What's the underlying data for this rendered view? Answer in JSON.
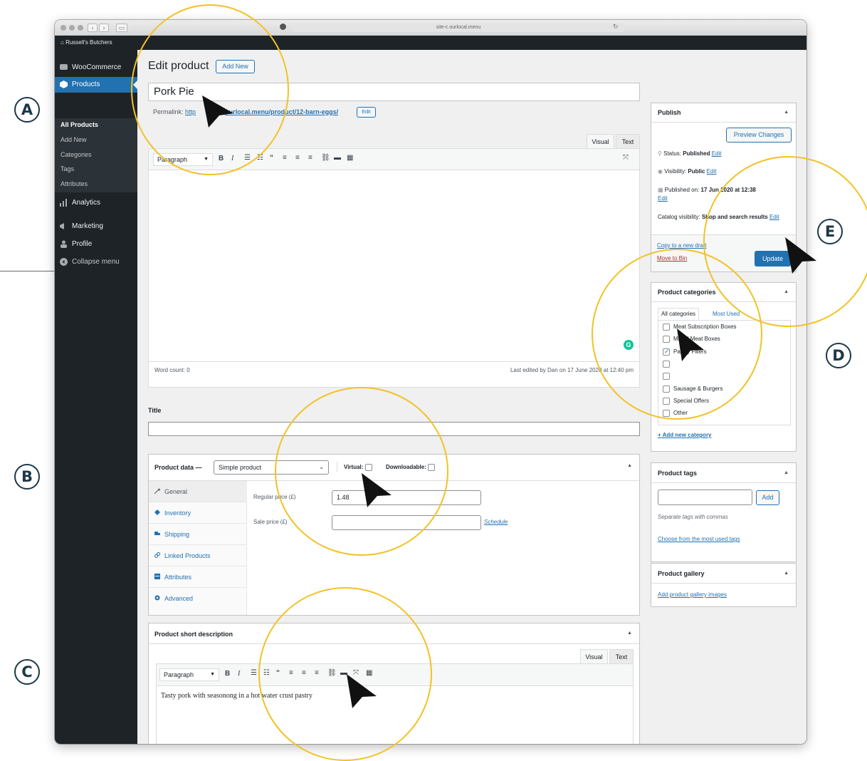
{
  "badges": {
    "a": "A",
    "b": "B",
    "c": "C",
    "d": "D",
    "e": "E"
  },
  "browser": {
    "url": "site-c.ourlocal.menu",
    "site_name": "Russell's Butchers"
  },
  "sidebar": {
    "woocommerce": "WooCommerce",
    "products": "Products",
    "submenu": [
      "All Products",
      "Add New",
      "Categories",
      "Tags",
      "Attributes"
    ],
    "analytics": "Analytics",
    "marketing": "Marketing",
    "profile": "Profile",
    "collapse": "Collapse menu"
  },
  "header": {
    "title": "Edit product",
    "add_new": "Add New"
  },
  "product": {
    "name": "Pork Pie",
    "permalink_label": "Permalink:",
    "permalink_start": "http",
    "permalink_end": "ourlocal.menu/product/12-barn-eggs/",
    "permalink_edit": "Edit"
  },
  "editor": {
    "tab_visual": "Visual",
    "tab_text": "Text",
    "format": "Paragraph",
    "word_count": "Word count: 0",
    "last_edited": "Last edited by Dan on 17 June 2020 at 12:40 pm"
  },
  "title_field": {
    "label": "Title"
  },
  "product_data": {
    "label": "Product data —",
    "type": "Simple product",
    "virtual": "Virtual:",
    "downloadable": "Downloadable:",
    "tabs": [
      "General",
      "Inventory",
      "Shipping",
      "Linked Products",
      "Attributes",
      "Advanced"
    ],
    "regular_price_label": "Regular price (£)",
    "regular_price": "1.48",
    "sale_price_label": "Sale price (£)",
    "schedule": "Schedule"
  },
  "short_desc": {
    "title": "Product short description",
    "tab_visual": "Visual",
    "tab_text": "Text",
    "format": "Paragraph",
    "content": "Tasty pork with seasonong in a hot water crust pastry"
  },
  "publish": {
    "title": "Publish",
    "preview": "Preview Changes",
    "status_label": "Status:",
    "status_value": "Published",
    "visibility_label": "Visibility:",
    "visibility_value": "Public",
    "published_on_label": "Published on:",
    "published_on_value": "17 Jun 2020 at 12:38",
    "catalog_label": "Catalog visibility:",
    "catalog_value": "Shop and search results",
    "edit": "Edit",
    "copy": "Copy to a new draft",
    "bin": "Move to Bin",
    "update": "Update"
  },
  "categories": {
    "title": "Product categories",
    "tab_all": "All categories",
    "tab_most": "Most Used",
    "items": [
      {
        "label": "Meat Subscription Boxes",
        "checked": false
      },
      {
        "label": "Mixed Meat Boxes",
        "checked": false
      },
      {
        "label": "Pantry Fillers",
        "checked": true
      },
      {
        "label": "",
        "checked": false
      },
      {
        "label": "",
        "checked": false
      },
      {
        "label": "Sausage & Burgers",
        "checked": false
      },
      {
        "label": "Special Offers",
        "checked": false
      },
      {
        "label": "Other",
        "checked": false
      }
    ],
    "add_new": "+ Add new category"
  },
  "tags": {
    "title": "Product tags",
    "add": "Add",
    "hint": "Separate tags with commas",
    "choose": "Choose from the most used tags"
  },
  "gallery": {
    "title": "Product gallery",
    "add": "Add product gallery images"
  },
  "colors": {
    "highlight": "#f2c224",
    "accent": "#2271b1",
    "sidebar": "#1d2327"
  }
}
